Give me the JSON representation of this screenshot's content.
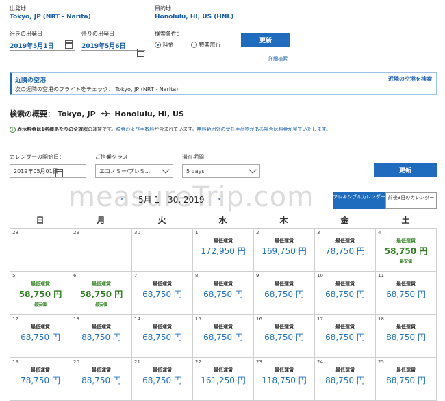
{
  "search": {
    "origin_label": "出発地",
    "origin_value": "Tokyo, JP (NRT - Narita)",
    "dest_label": "目的地",
    "dest_value": "Honolulu, HI, US (HNL)",
    "depart_label": "行きの出発日",
    "depart_value": "2019年5月1日",
    "return_label": "帰りの出発日",
    "return_value": "2019年5月6日",
    "condition_label": "検索条件：",
    "radio_fare": "料金",
    "radio_award": "特典旅行",
    "update_button": "更新",
    "advanced_link": "詳細検索"
  },
  "nearby": {
    "title": "近隣の空港",
    "text": "次の近隣の空港のフライトをチェック： Tokyo, JP (NRT - Narita).",
    "link": "近隣の空港を検索"
  },
  "summary": {
    "heading_prefix": "検索の概要：",
    "from": "Tokyo, JP",
    "to": "Honolulu, HI, US"
  },
  "notice": {
    "text_bold": "表示料金は1名様あたりの全旅程",
    "text_plain1": "の運賃です。",
    "text_link1": "税金および手数料",
    "text_plain2": "が含まれています。",
    "text_link2": "無料範囲外の受託手荷物がある場合は料金が発生いたします。"
  },
  "filters": {
    "cal_start_label": "カレンダーの開始日：",
    "cal_start_value": "2019年05月01日",
    "class_label": "ご搭乗クラス",
    "class_value": "エコノミー/プレミ...",
    "stay_label": "滞在期間",
    "stay_value": "5 days",
    "update_button": "更新"
  },
  "calendar": {
    "month_label": "5月 1 - 30, 2019",
    "tab_flexible": "フレキシブルカレンダー",
    "tab_3days": "前後3日のカレンダー",
    "weekdays": [
      "日",
      "月",
      "火",
      "水",
      "木",
      "金",
      "土"
    ],
    "fare_caption": "最低運賃",
    "best_caption": "最安値",
    "cells": [
      {
        "day": "28",
        "price": ""
      },
      {
        "day": "29",
        "price": ""
      },
      {
        "day": "30",
        "price": ""
      },
      {
        "day": "1",
        "price": "172,950 円"
      },
      {
        "day": "2",
        "price": "169,750 円"
      },
      {
        "day": "3",
        "price": "78,750 円"
      },
      {
        "day": "4",
        "price": "58,750 円",
        "lowest": true
      },
      {
        "day": "5",
        "price": "58,750 円",
        "lowest": true
      },
      {
        "day": "6",
        "price": "58,750 円",
        "lowest": true
      },
      {
        "day": "7",
        "price": "68,750 円"
      },
      {
        "day": "8",
        "price": "68,750 円"
      },
      {
        "day": "9",
        "price": "68,750 円"
      },
      {
        "day": "10",
        "price": "68,750 円"
      },
      {
        "day": "11",
        "price": "68,750 円"
      },
      {
        "day": "12",
        "price": "68,750 円"
      },
      {
        "day": "13",
        "price": "88,750 円"
      },
      {
        "day": "14",
        "price": "68,750 円"
      },
      {
        "day": "15",
        "price": "68,750 円"
      },
      {
        "day": "16",
        "price": "68,750 円"
      },
      {
        "day": "17",
        "price": "68,750 円"
      },
      {
        "day": "18",
        "price": "88,750 円"
      },
      {
        "day": "19",
        "price": "78,750 円"
      },
      {
        "day": "20",
        "price": "88,750 円"
      },
      {
        "day": "21",
        "price": "68,750 円"
      },
      {
        "day": "22",
        "price": "161,250 円"
      },
      {
        "day": "23",
        "price": "118,750 円"
      },
      {
        "day": "24",
        "price": "88,750 円"
      },
      {
        "day": "25",
        "price": "88,750 円"
      }
    ]
  },
  "watermark": "measureTrip.com",
  "colors": {
    "accent": "#1f6bbd",
    "lowest": "#2e7d1f",
    "link": "#1a5faa"
  }
}
